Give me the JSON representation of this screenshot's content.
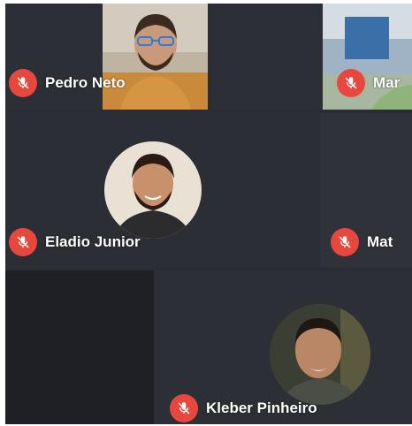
{
  "participants": [
    {
      "name": "Pedro Neto",
      "mic_state": "muted",
      "view": "video"
    },
    {
      "name": "Mar",
      "mic_state": "muted",
      "view": "video"
    },
    {
      "name": "Eladio Junior",
      "mic_state": "muted",
      "view": "avatar"
    },
    {
      "name": "Mat",
      "mic_state": "muted",
      "view": "tile"
    },
    {
      "name": "Kleber Pinheiro",
      "mic_state": "muted",
      "view": "avatar"
    }
  ],
  "colors": {
    "background": "#2a2d33",
    "tile": "#32353b",
    "tile_dark": "#1e2025",
    "muted_badge": "#e8473d",
    "label_text": "#ffffff"
  },
  "icons": {
    "muted": "mic-off-icon"
  }
}
